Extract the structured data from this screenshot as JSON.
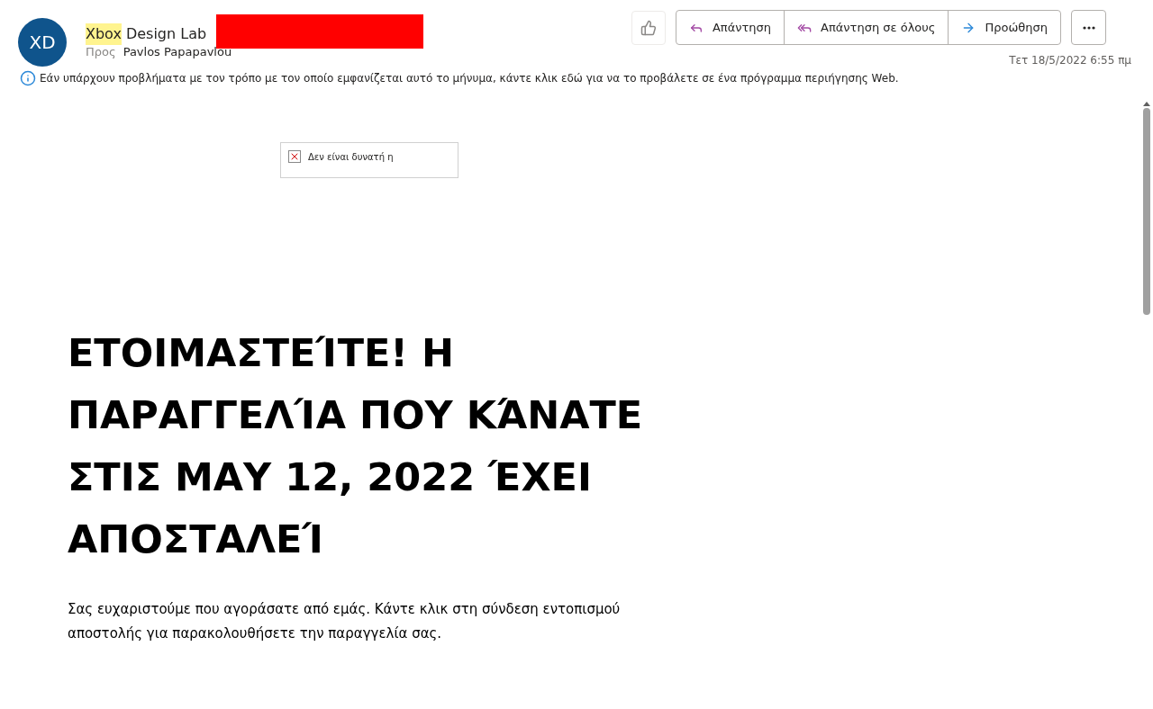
{
  "header": {
    "avatar_initials": "XD",
    "sender_parts": [
      {
        "text": "Xbox",
        "highlighted": true
      },
      {
        "text": "Design Lab",
        "highlighted": false
      }
    ],
    "to_label": "Προς",
    "to_name": "Pavlos Papapavlou",
    "actions": [
      {
        "kind": "reply",
        "label": "Απάντηση"
      },
      {
        "kind": "reply_all",
        "label": "Απάντηση σε όλους"
      },
      {
        "kind": "forward",
        "label": "Προώθηση"
      }
    ],
    "date": "Τετ 18/5/2022 6:55 πμ"
  },
  "info_bar": "Εάν υπάρχουν προβλήματα με τον τρόπο με τον οποίο εμφανίζεται αυτό το μήνυμα, κάντε κλικ εδώ για να το προβάλετε σε ένα πρόγραμμα περιήγησης Web.",
  "body": {
    "broken_image_text": "Δεν είναι δυνατή η",
    "heading_lines": [
      "ΕΤΟΙΜΑΣΤΕΊΤΕ! Η",
      "ΠΑΡΑΓΓΕΛΊΑ ΠΟΥ ΚΆΝΑΤΕ",
      "ΣΤΙΣ ΜΑΥ 12, 2022 ΈΧΕΙ",
      "ΑΠΟΣΤΑΛΕΊ"
    ],
    "paragraph": "Σας ευχαριστούμε που αγοράσατε από εμάς. Κάντε κλικ στη σύνδεση εντοπισμού αποστολής για παρακολουθήσετε την παραγγελία σας."
  }
}
